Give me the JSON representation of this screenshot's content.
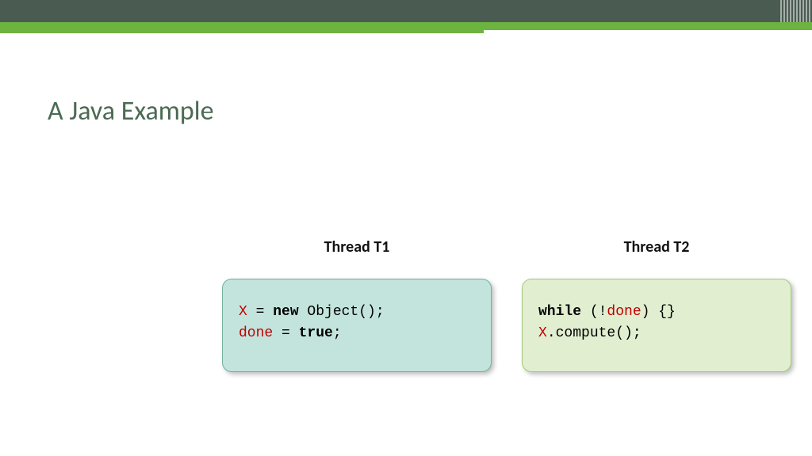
{
  "title": "A Java Example",
  "threads": {
    "t1": {
      "header": "Thread T1"
    },
    "t2": {
      "header": "Thread T2"
    }
  },
  "code": {
    "t1": {
      "l1": {
        "a": "X",
        "b": " = ",
        "c": "new",
        "d": " Object();"
      },
      "l2": {
        "a": "done",
        "b": " = ",
        "c": "true",
        "d": ";"
      }
    },
    "t2": {
      "l1": {
        "a": "while",
        "b": " (!",
        "c": "done",
        "d": ") {}"
      },
      "l2": {
        "a": "X",
        "b": ".compute();"
      }
    }
  }
}
